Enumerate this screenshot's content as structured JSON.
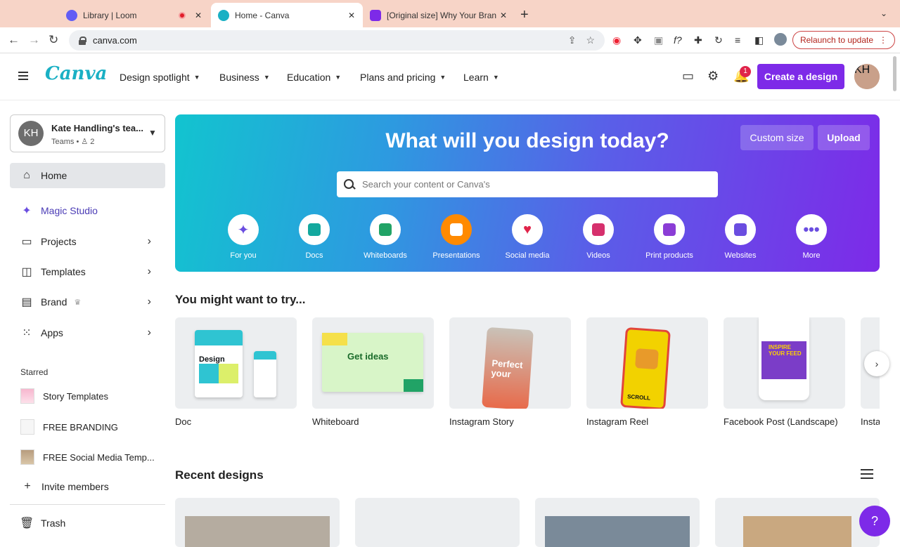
{
  "browser": {
    "tabs": [
      {
        "title": "Library | Loom",
        "favicon_color": "#625df5"
      },
      {
        "title": "Home - Canva",
        "favicon_color": "#1ab0c4"
      },
      {
        "title": "[Original size] Why Your Brand",
        "favicon_color": "#7d2ae8"
      }
    ],
    "url": "canva.com",
    "relaunch_label": "Relaunch to update"
  },
  "header": {
    "logo": "Canva",
    "nav": [
      "Design spotlight",
      "Business",
      "Education",
      "Plans and pricing",
      "Learn"
    ],
    "notification_count": "1",
    "create_label": "Create a design",
    "avatar_initials": "KH"
  },
  "sidebar": {
    "team_initials": "KH",
    "team_name": "Kate Handling's tea...",
    "team_sub": "Teams • ♙ 2",
    "items": [
      {
        "label": "Home",
        "icon": "home-icon"
      },
      {
        "label": "Magic Studio",
        "icon": "sparkle-icon"
      },
      {
        "label": "Projects",
        "icon": "folder-icon"
      },
      {
        "label": "Templates",
        "icon": "templates-icon"
      },
      {
        "label": "Brand",
        "icon": "brand-icon"
      },
      {
        "label": "Apps",
        "icon": "apps-icon"
      }
    ],
    "starred_heading": "Starred",
    "starred": [
      "Story Templates",
      "FREE BRANDING",
      "FREE Social Media Temp..."
    ],
    "invite_label": "Invite members",
    "trash_label": "Trash"
  },
  "hero": {
    "title": "What will you design today?",
    "custom_size": "Custom size",
    "upload": "Upload",
    "search_placeholder": "Search your content or Canva's",
    "categories": [
      {
        "label": "For you",
        "color": "#6a4de0"
      },
      {
        "label": "Docs",
        "color": "#13a89e"
      },
      {
        "label": "Whiteboards",
        "color": "#21a366"
      },
      {
        "label": "Presentations",
        "color": "#ff8a00"
      },
      {
        "label": "Social media",
        "color": "#e0244a"
      },
      {
        "label": "Videos",
        "color": "#d6306d"
      },
      {
        "label": "Print products",
        "color": "#8b3dd6"
      },
      {
        "label": "Websites",
        "color": "#6a4de0"
      },
      {
        "label": "More",
        "color": "#6a4de0"
      }
    ]
  },
  "try": {
    "heading": "You might want to try...",
    "cards": [
      "Doc",
      "Whiteboard",
      "Instagram Story",
      "Instagram Reel",
      "Facebook Post (Landscape)",
      "Insta"
    ]
  },
  "recent": {
    "heading": "Recent designs"
  },
  "help_label": "?"
}
